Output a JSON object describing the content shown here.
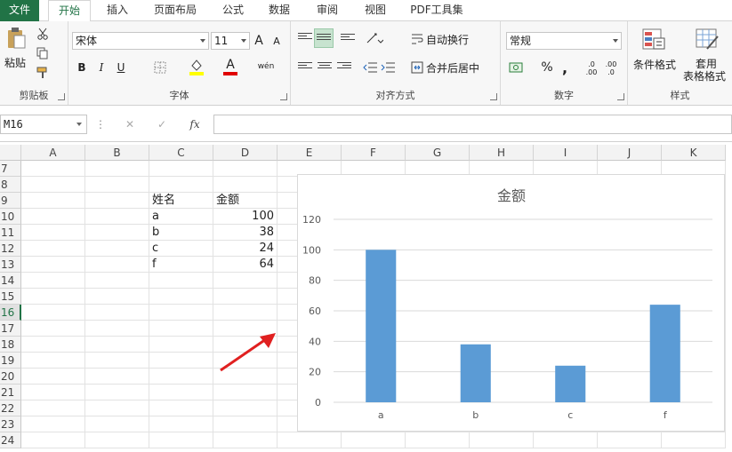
{
  "ribbon_tabs": [
    "文件",
    "开始",
    "插入",
    "页面布局",
    "公式",
    "数据",
    "审阅",
    "视图",
    "PDF工具集"
  ],
  "clipboard": {
    "paste_label": "粘贴",
    "group_label": "剪贴板"
  },
  "font": {
    "name": "宋体",
    "size": "11",
    "grow": "A",
    "shrink": "A",
    "bold": "B",
    "italic": "I",
    "underline": "U",
    "color_letter": "A",
    "phonetic": "wén",
    "group_label": "字体"
  },
  "alignment": {
    "wrap_text": "自动换行",
    "merge_center": "合并后居中",
    "group_label": "对齐方式"
  },
  "number": {
    "format": "常规",
    "percent": "%",
    "comma": ",",
    "inc_decimal": ".0 .00",
    "dec_decimal": ".00 .0",
    "group_label": "数字"
  },
  "styles": {
    "conditional": "条件格式",
    "table_format_1": "套用",
    "table_format_2": "表格格式",
    "group_label": "样式"
  },
  "formula_bar": {
    "name_box": "M16",
    "fx": "fx",
    "cancel": "✕",
    "enter": "✓",
    "more": "⋮",
    "content": ""
  },
  "columns": [
    "A",
    "B",
    "C",
    "D",
    "E",
    "F",
    "G",
    "H",
    "I",
    "J",
    "K"
  ],
  "rows": [
    "7",
    "8",
    "9",
    "10",
    "11",
    "12",
    "13",
    "14",
    "15",
    "16",
    "17",
    "18",
    "19",
    "20",
    "21",
    "22",
    "23",
    "24"
  ],
  "selected_row": "16",
  "table": {
    "header": {
      "name": "姓名",
      "amount": "金额"
    },
    "records": [
      {
        "name": "a",
        "amount": "100"
      },
      {
        "name": "b",
        "amount": "38"
      },
      {
        "name": "c",
        "amount": "24"
      },
      {
        "name": "f",
        "amount": "64"
      }
    ]
  },
  "colors": {
    "excel_green": "#217346",
    "bar": "#5b9bd5",
    "arrow": "#e02020",
    "highlight": "#ffff00",
    "font_red": "#e00000"
  },
  "chart_data": {
    "type": "bar",
    "title": "金额",
    "categories": [
      "a",
      "b",
      "c",
      "f"
    ],
    "values": [
      100,
      38,
      24,
      64
    ],
    "ylim": [
      0,
      120
    ],
    "yticks": [
      0,
      20,
      40,
      60,
      80,
      100,
      120
    ],
    "grid": true,
    "xlabel": "",
    "ylabel": ""
  }
}
